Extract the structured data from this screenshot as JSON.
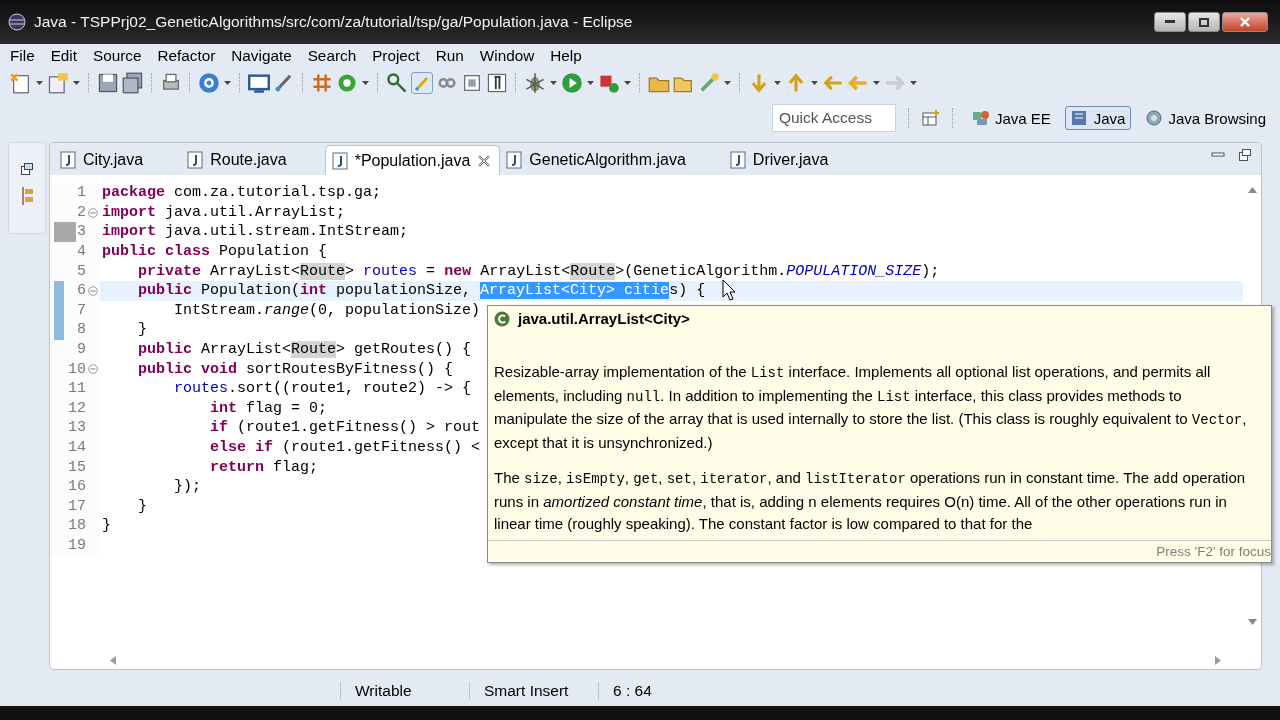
{
  "window": {
    "title": "Java - TSPPrj02_GeneticAlgorithms/src/com/za/tutorial/tsp/ga/Population.java - Eclipse"
  },
  "menu": [
    "File",
    "Edit",
    "Source",
    "Refactor",
    "Navigate",
    "Search",
    "Project",
    "Run",
    "Window",
    "Help"
  ],
  "quick_access": {
    "placeholder": "Quick Access"
  },
  "perspectives": [
    {
      "label": "Java EE",
      "selected": false
    },
    {
      "label": "Java",
      "selected": true
    },
    {
      "label": "Java Browsing",
      "selected": false
    }
  ],
  "editor_tabs": [
    {
      "label": "City.java",
      "selected": false
    },
    {
      "label": "Route.java",
      "selected": false
    },
    {
      "label": "*Population.java",
      "selected": true
    },
    {
      "label": "GeneticAlgorithm.java",
      "selected": false
    },
    {
      "label": "Driver.java",
      "selected": false
    }
  ],
  "code_lines": [
    {
      "number": "1",
      "foldable": false,
      "diff_changed": false,
      "diff_added": false,
      "current": false,
      "segments": [
        {
          "text": "package",
          "kind": "keyword"
        },
        {
          "text": " com.za.tutorial.tsp.ga;",
          "kind": "plain"
        }
      ]
    },
    {
      "number": "2",
      "foldable": true,
      "diff_changed": false,
      "diff_added": false,
      "current": false,
      "segments": [
        {
          "text": "import",
          "kind": "keyword"
        },
        {
          "text": " java.util.ArrayList;",
          "kind": "plain"
        }
      ]
    },
    {
      "number": "3",
      "foldable": false,
      "diff_changed": true,
      "diff_added": false,
      "current": false,
      "segments": [
        {
          "text": "import",
          "kind": "keyword"
        },
        {
          "text": " java.util.stream.IntStream;",
          "kind": "plain"
        }
      ]
    },
    {
      "number": "4",
      "foldable": false,
      "diff_changed": false,
      "diff_added": false,
      "current": false,
      "segments": [
        {
          "text": "public",
          "kind": "keyword"
        },
        {
          "text": " class",
          "kind": "keyword"
        },
        {
          "text": " Population {",
          "kind": "plain"
        }
      ]
    },
    {
      "number": "5",
      "foldable": false,
      "diff_changed": false,
      "diff_added": false,
      "current": false,
      "segments": [
        {
          "text": "    private",
          "kind": "keyword"
        },
        {
          "text": " ArrayList<",
          "kind": "plain"
        },
        {
          "text": "Route",
          "kind": "occurrence"
        },
        {
          "text": "> ",
          "kind": "plain"
        },
        {
          "text": "routes",
          "kind": "field"
        },
        {
          "text": " = ",
          "kind": "plain"
        },
        {
          "text": "new",
          "kind": "keyword"
        },
        {
          "text": " ArrayList<",
          "kind": "plain"
        },
        {
          "text": "Route",
          "kind": "occurrence"
        },
        {
          "text": ">(GeneticAlgorithm.",
          "kind": "plain"
        },
        {
          "text": "POPULATION_SIZE",
          "kind": "static"
        },
        {
          "text": ");",
          "kind": "plain"
        }
      ]
    },
    {
      "number": "6",
      "foldable": true,
      "diff_changed": false,
      "diff_added": true,
      "current": true,
      "segments": [
        {
          "text": "    public",
          "kind": "keyword"
        },
        {
          "text": " Population(",
          "kind": "plain"
        },
        {
          "text": "int",
          "kind": "keyword"
        },
        {
          "text": " populationSize, ",
          "kind": "plain"
        },
        {
          "text": "ArrayList<City> citie",
          "kind": "selected"
        },
        {
          "text": "s) {",
          "kind": "plain"
        }
      ]
    },
    {
      "number": "7",
      "foldable": false,
      "diff_changed": false,
      "diff_added": true,
      "current": false,
      "segments": [
        {
          "text": "        IntStream.",
          "kind": "plain"
        },
        {
          "text": "range",
          "kind": "italic"
        },
        {
          "text": "(0, populationSize)",
          "kind": "plain"
        }
      ]
    },
    {
      "number": "8",
      "foldable": false,
      "diff_changed": false,
      "diff_added": true,
      "current": false,
      "segments": [
        {
          "text": "    }",
          "kind": "plain"
        }
      ]
    },
    {
      "number": "9",
      "foldable": false,
      "diff_changed": false,
      "diff_added": false,
      "current": false,
      "segments": [
        {
          "text": "    public",
          "kind": "keyword"
        },
        {
          "text": " ArrayList<",
          "kind": "plain"
        },
        {
          "text": "Route",
          "kind": "occurrence"
        },
        {
          "text": "> getRoutes() {",
          "kind": "plain"
        }
      ]
    },
    {
      "number": "10",
      "foldable": true,
      "diff_changed": false,
      "diff_added": false,
      "current": false,
      "segments": [
        {
          "text": "    public",
          "kind": "keyword"
        },
        {
          "text": " void",
          "kind": "keyword"
        },
        {
          "text": " sortRoutesByFitness() {",
          "kind": "plain"
        }
      ]
    },
    {
      "number": "11",
      "foldable": false,
      "diff_changed": false,
      "diff_added": false,
      "current": false,
      "segments": [
        {
          "text": "        routes",
          "kind": "field"
        },
        {
          "text": ".sort((route1, route2) -> {",
          "kind": "plain"
        }
      ]
    },
    {
      "number": "12",
      "foldable": false,
      "diff_changed": false,
      "diff_added": false,
      "current": false,
      "segments": [
        {
          "text": "            int",
          "kind": "keyword"
        },
        {
          "text": " flag = 0;",
          "kind": "plain"
        }
      ]
    },
    {
      "number": "13",
      "foldable": false,
      "diff_changed": false,
      "diff_added": false,
      "current": false,
      "segments": [
        {
          "text": "            if",
          "kind": "keyword"
        },
        {
          "text": " (route1.getFitness() > rout",
          "kind": "plain"
        }
      ]
    },
    {
      "number": "14",
      "foldable": false,
      "diff_changed": false,
      "diff_added": false,
      "current": false,
      "segments": [
        {
          "text": "            else",
          "kind": "keyword"
        },
        {
          "text": " if",
          "kind": "keyword"
        },
        {
          "text": " (route1.getFitness() <",
          "kind": "plain"
        }
      ]
    },
    {
      "number": "15",
      "foldable": false,
      "diff_changed": false,
      "diff_added": false,
      "current": false,
      "segments": [
        {
          "text": "            return",
          "kind": "keyword"
        },
        {
          "text": " flag;",
          "kind": "plain"
        }
      ]
    },
    {
      "number": "16",
      "foldable": false,
      "diff_changed": false,
      "diff_added": false,
      "current": false,
      "segments": [
        {
          "text": "        });",
          "kind": "plain"
        }
      ]
    },
    {
      "number": "17",
      "foldable": false,
      "diff_changed": false,
      "diff_added": false,
      "current": false,
      "segments": [
        {
          "text": "    }",
          "kind": "plain"
        }
      ]
    },
    {
      "number": "18",
      "foldable": false,
      "diff_changed": false,
      "diff_added": false,
      "current": false,
      "segments": [
        {
          "text": "}",
          "kind": "plain"
        }
      ]
    },
    {
      "number": "19",
      "foldable": false,
      "diff_changed": false,
      "diff_added": false,
      "current": false
    }
  ],
  "hover": {
    "title": "java.util.ArrayList<City>",
    "paragraphs": [
      [
        {
          "text": "Resizable-array implementation of the ",
          "kind": "text"
        },
        {
          "text": "List",
          "kind": "code"
        },
        {
          "text": " interface. Implements all optional list operations, and permits all elements, including ",
          "kind": "text"
        },
        {
          "text": "null",
          "kind": "code"
        },
        {
          "text": ". In addition to implementing the ",
          "kind": "text"
        },
        {
          "text": "List",
          "kind": "code"
        },
        {
          "text": " interface, this class provides methods to manipulate the size of the array that is used internally to store the list. (This class is roughly equivalent to ",
          "kind": "text"
        },
        {
          "text": "Vector",
          "kind": "code"
        },
        {
          "text": ", except that it is unsynchronized.)",
          "kind": "text"
        }
      ],
      [
        {
          "text": "The ",
          "kind": "text"
        },
        {
          "text": "size",
          "kind": "code"
        },
        {
          "text": ", ",
          "kind": "text"
        },
        {
          "text": "isEmpty",
          "kind": "code"
        },
        {
          "text": ", ",
          "kind": "text"
        },
        {
          "text": "get",
          "kind": "code"
        },
        {
          "text": ", ",
          "kind": "text"
        },
        {
          "text": "set",
          "kind": "code"
        },
        {
          "text": ", ",
          "kind": "text"
        },
        {
          "text": "iterator",
          "kind": "code"
        },
        {
          "text": ", and ",
          "kind": "text"
        },
        {
          "text": "listIterator",
          "kind": "code"
        },
        {
          "text": " operations run in constant time. The ",
          "kind": "text"
        },
        {
          "text": "add",
          "kind": "code"
        },
        {
          "text": " operation runs in ",
          "kind": "text"
        },
        {
          "text": "amortized constant time",
          "kind": "italic"
        },
        {
          "text": ", that is, adding n elements requires O(n) time. All of the other operations run in linear time (roughly speaking). The constant factor is low compared to that for the",
          "kind": "text"
        }
      ]
    ],
    "footer": "Press 'F2' for focus"
  },
  "status_bar": [
    "Writable",
    "Smart Insert",
    "6 : 64"
  ]
}
